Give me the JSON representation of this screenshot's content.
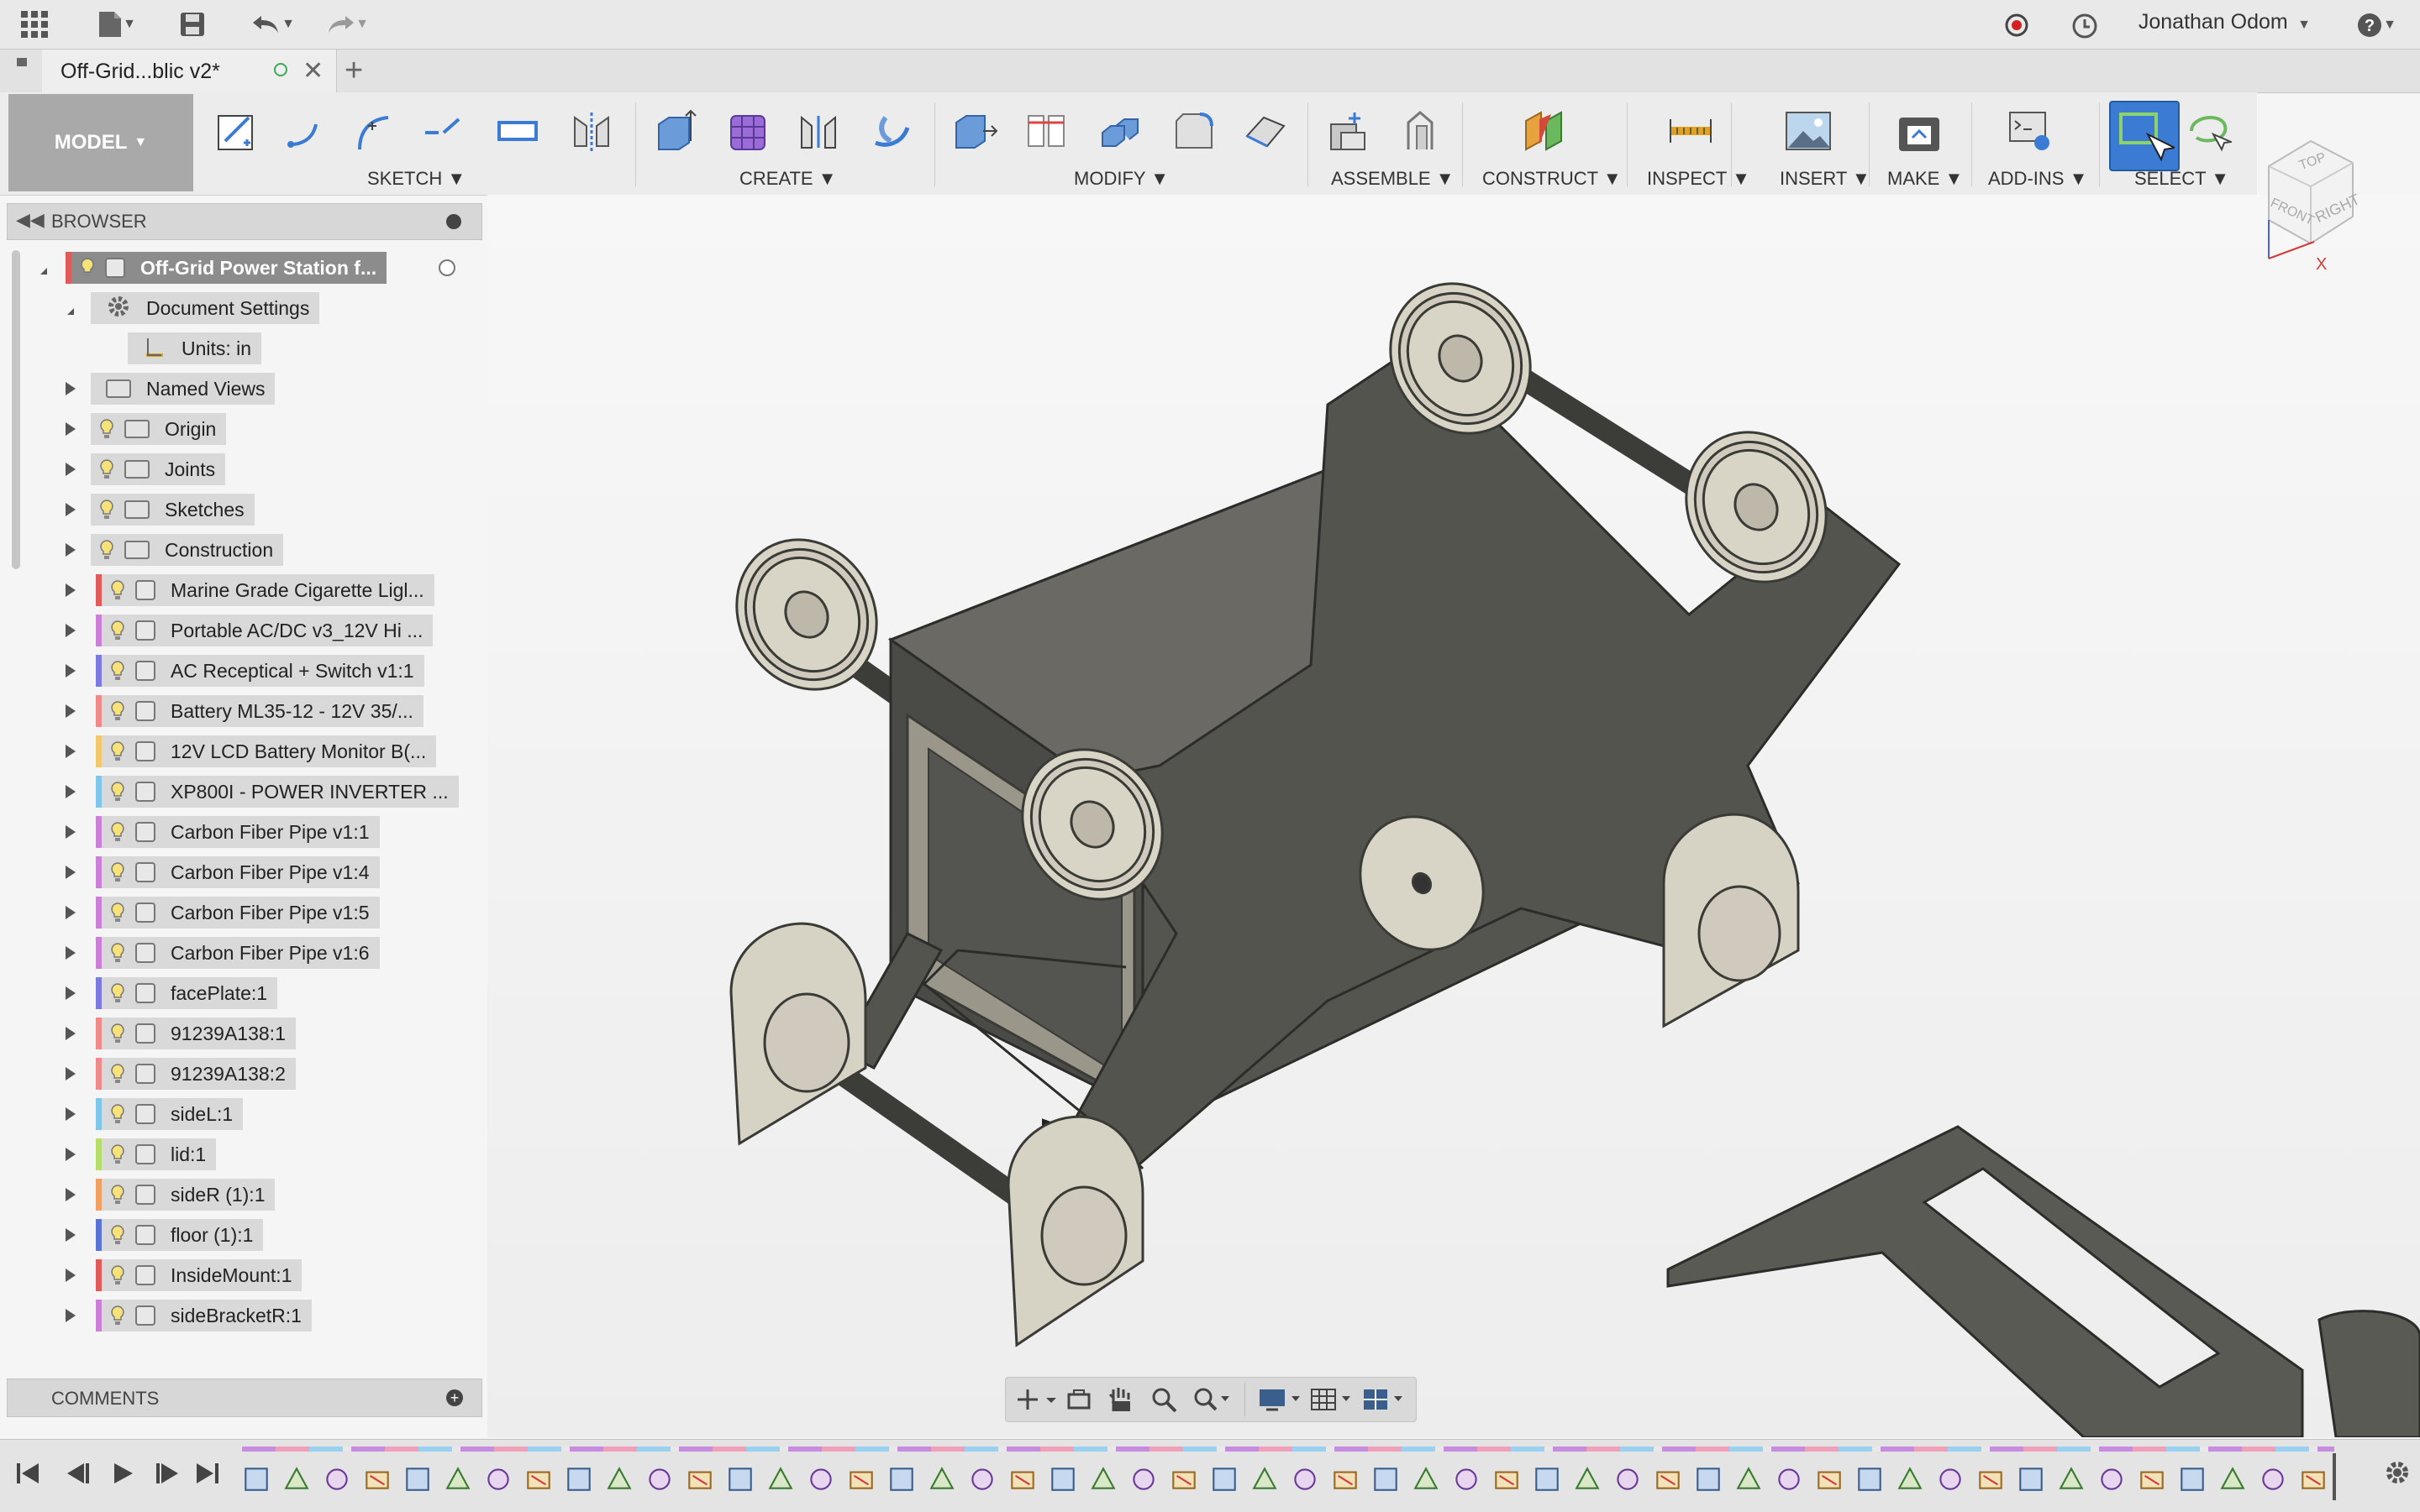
{
  "app": {
    "user_name": "Jonathan Odom",
    "icons": [
      "apps-grid-icon",
      "file-icon",
      "save-icon",
      "undo-icon",
      "redo-icon",
      "record-icon",
      "clock-icon",
      "help-icon"
    ]
  },
  "document_tab": {
    "title": "Off-Grid...blic v2*",
    "new_tab_symbol": "+"
  },
  "ribbon": {
    "workspace": "MODEL",
    "groups": [
      {
        "label": "SKETCH"
      },
      {
        "label": "CREATE"
      },
      {
        "label": "MODIFY"
      },
      {
        "label": "ASSEMBLE"
      },
      {
        "label": "CONSTRUCT"
      },
      {
        "label": "INSPECT"
      },
      {
        "label": "INSERT"
      },
      {
        "label": "MAKE"
      },
      {
        "label": "ADD-INS"
      },
      {
        "label": "SELECT"
      }
    ]
  },
  "view_cube": {
    "top": "TOP",
    "front": "FRONT",
    "right": "RIGHT",
    "axis": "X"
  },
  "browser": {
    "title": "BROWSER",
    "root": "Off-Grid Power Station f...",
    "document_settings": "Document Settings",
    "units": "Units: in",
    "folders": [
      "Named Views",
      "Origin",
      "Joints",
      "Sketches",
      "Construction"
    ],
    "components": [
      {
        "label": "Marine Grade Cigarette Ligl...",
        "color": "#e05a5a"
      },
      {
        "label": "Portable AC/DC v3_12V Hi ...",
        "color": "#cc7fd6"
      },
      {
        "label": "AC Receptical + Switch v1:1",
        "color": "#7a7ae0"
      },
      {
        "label": "Battery ML35-12 - 12V 35/...",
        "color": "#f08a8a"
      },
      {
        "label": "12V LCD Battery Monitor B(...",
        "color": "#f2c86a"
      },
      {
        "label": "XP800I - POWER INVERTER ...",
        "color": "#7ec6ea"
      },
      {
        "label": "Carbon Fiber Pipe v1:1",
        "color": "#cc7fd6"
      },
      {
        "label": "Carbon Fiber Pipe v1:4",
        "color": "#cc7fd6"
      },
      {
        "label": "Carbon Fiber Pipe v1:5",
        "color": "#cc7fd6"
      },
      {
        "label": "Carbon Fiber Pipe v1:6",
        "color": "#cc7fd6"
      },
      {
        "label": "facePlate:1",
        "color": "#7a7ae0"
      },
      {
        "label": "91239A138:1",
        "color": "#f08a8a"
      },
      {
        "label": "91239A138:2",
        "color": "#f08a8a"
      },
      {
        "label": "sideL:1",
        "color": "#7ec6ea"
      },
      {
        "label": "lid:1",
        "color": "#b6de6a"
      },
      {
        "label": "sideR (1):1",
        "color": "#f0a060"
      },
      {
        "label": "floor (1):1",
        "color": "#5b73d6"
      },
      {
        "label": "InsideMount:1",
        "color": "#e05a5a"
      },
      {
        "label": "sideBracketR:1",
        "color": "#cc7fd6"
      }
    ]
  },
  "comments": {
    "title": "COMMENTS"
  },
  "timeline": {
    "feature_count": 52
  }
}
